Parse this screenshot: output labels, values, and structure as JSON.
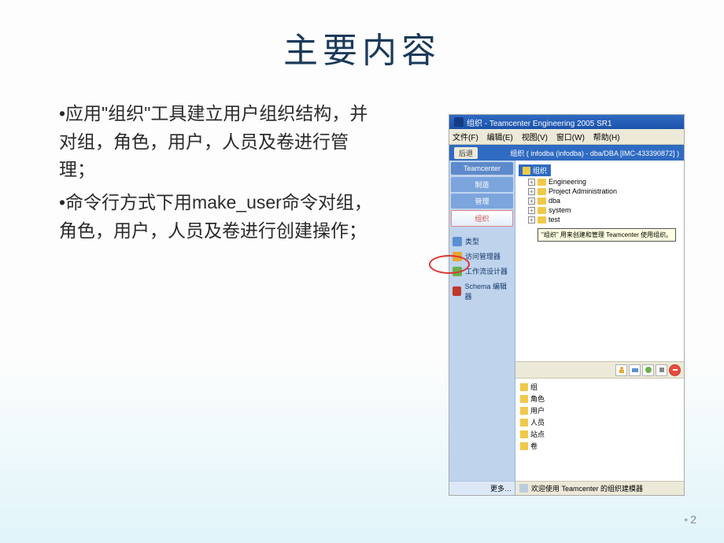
{
  "slide": {
    "title": "主要内容",
    "bullet1": "•应用\"组织\"工具建立用户组织结构，并对组，角色，用户，人员及卷进行管理；",
    "bullet2": "•命令行方式下用make_user命令对组，角色，用户，人员及卷进行创建操作；",
    "page_number": "2"
  },
  "app": {
    "window_title": "组织 - Teamcenter Engineering 2005 SR1",
    "menu": {
      "file": "文件(F)",
      "edit": "编辑(E)",
      "view": "视图(V)",
      "window": "窗口(W)",
      "help": "帮助(H)"
    },
    "toolbar": {
      "back": "后退",
      "path": "组织 ( infodba (infodba) - dba/DBA  [IMC-433390872] )"
    },
    "sidebar": {
      "header": "Teamcenter",
      "btn_make": "制造",
      "btn_manage": "管理",
      "btn_org": "组织",
      "item_type": "类型",
      "item_visitor": "访问管理器",
      "item_design": "工作流设计器",
      "item_schema": "Schema 编辑器",
      "more": "更多…"
    },
    "tree_top": {
      "root": "组织",
      "n1": "Engineering",
      "n2": "Project Administration",
      "n3": "dba",
      "n4": "system",
      "n5": "test",
      "tooltip": "\"组织\" 用来创建和管理 Teamcenter 使用组织。"
    },
    "tree_bot": {
      "b1": "组",
      "b2": "角色",
      "b3": "用户",
      "b4": "人员",
      "b5": "站点",
      "b6": "卷"
    },
    "status": "欢迎使用 Teamcenter 的组织建模器"
  }
}
